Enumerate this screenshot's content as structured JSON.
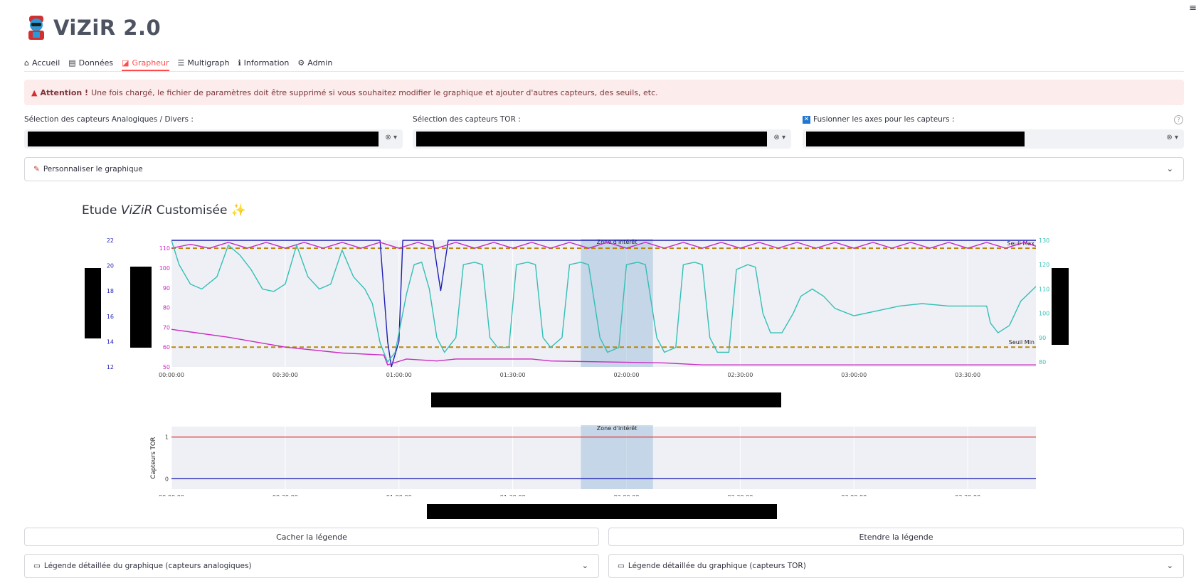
{
  "app": {
    "title": "ViZiR 2.0"
  },
  "tabs": [
    {
      "icon": "home-icon",
      "glyph": "⌂",
      "label": "Accueil"
    },
    {
      "icon": "data-icon",
      "glyph": "▤",
      "label": "Données"
    },
    {
      "icon": "chart-icon",
      "glyph": "◪",
      "label": "Grapheur",
      "active": true
    },
    {
      "icon": "list-icon",
      "glyph": "☰",
      "label": "Multigraph"
    },
    {
      "icon": "info-icon",
      "glyph": "ℹ",
      "label": "Information"
    },
    {
      "icon": "admin-icon",
      "glyph": "⚙",
      "label": "Admin"
    }
  ],
  "alert": {
    "bold": "Attention !",
    "text": "Une fois chargé, le fichier de paramètres doit être supprimé si vous souhaitez modifier le graphique et ajouter d'autres capteurs, des seuils, etc."
  },
  "selectors": {
    "analog_label": "Sélection des capteurs Analogiques / Divers :",
    "tor_label": "Sélection des capteurs TOR :",
    "merge_label": "Fusionner les axes pour les capteurs :",
    "ctrl_glyph": "⊗ ▾",
    "help_glyph": "?"
  },
  "expander": {
    "label": "Personnaliser le graphique"
  },
  "section": {
    "prefix": "Etude ",
    "emph": "ViZiR",
    "suffix": " Customisée",
    "emoji": "✨"
  },
  "buttons": {
    "hide_legend": "Cacher la légende",
    "extend_legend": "Etendre la légende"
  },
  "legends": {
    "analog": "Légende détaillée du graphique (capteurs analogiques)",
    "tor": "Légende détaillée du graphique (capteurs TOR)"
  },
  "colors": {
    "accent": "#ff4b4b",
    "plot_bg": "#e5ecf6",
    "zone": "#a9c4de",
    "blue": "#1f1fb4",
    "magenta": "#cc29c4",
    "teal": "#33bfb5",
    "threshold": "#b8860b",
    "red": "#e04646"
  },
  "chart_data": [
    {
      "type": "line",
      "title": "",
      "x_ticks": [
        "00:00:00",
        "00:30:00",
        "01:00:00",
        "01:30:00",
        "02:00:00",
        "02:30:00",
        "03:00:00",
        "03:30:00"
      ],
      "xlim": [
        "00:00:00",
        "03:48:00"
      ],
      "y_axes": [
        {
          "id": "blue",
          "side": "left",
          "ticks": [
            12,
            14,
            16,
            18,
            20,
            22
          ],
          "range": [
            12,
            22
          ]
        },
        {
          "id": "magenta",
          "side": "left",
          "ticks": [
            50,
            60,
            70,
            80,
            90,
            100,
            110
          ],
          "range": [
            50,
            114
          ]
        },
        {
          "id": "teal",
          "side": "right",
          "ticks": [
            80,
            90,
            100,
            110,
            120,
            130
          ],
          "range": [
            78,
            130
          ]
        }
      ],
      "zone": {
        "label": "Zone d'intérêt",
        "x0": "01:48:00",
        "x1": "02:07:00"
      },
      "thresholds": [
        {
          "label": "Seuil Max",
          "axis": "magenta",
          "value": 110
        },
        {
          "label": "Seuil Min",
          "axis": "magenta",
          "value": 60
        }
      ],
      "series": [
        {
          "axis": "blue",
          "color": "blue",
          "points": [
            [
              0,
              22
            ],
            [
              55,
              22
            ],
            [
              57,
              14
            ],
            [
              58,
              12
            ],
            [
              60,
              14
            ],
            [
              61,
              22
            ],
            [
              69,
              22
            ],
            [
              70,
              20
            ],
            [
              71,
              18
            ],
            [
              72,
              20
            ],
            [
              73,
              22
            ],
            [
              78,
              22
            ],
            [
              79,
              22
            ],
            [
              228,
              22
            ]
          ]
        },
        {
          "axis": "magenta",
          "color": "magenta",
          "points": [
            [
              0,
              110
            ],
            [
              5,
              112
            ],
            [
              10,
              110
            ],
            [
              15,
              113
            ],
            [
              20,
              110
            ],
            [
              25,
              113
            ],
            [
              30,
              110
            ],
            [
              35,
              113
            ],
            [
              40,
              110
            ],
            [
              45,
              113
            ],
            [
              50,
              110
            ],
            [
              55,
              113
            ],
            [
              60,
              110
            ],
            [
              65,
              113
            ],
            [
              70,
              110
            ],
            [
              75,
              113
            ],
            [
              80,
              110
            ],
            [
              85,
              113
            ],
            [
              90,
              110
            ],
            [
              95,
              113
            ],
            [
              100,
              110
            ],
            [
              105,
              113
            ],
            [
              110,
              110
            ],
            [
              115,
              113
            ],
            [
              120,
              110
            ],
            [
              125,
              113
            ],
            [
              130,
              110
            ],
            [
              135,
              113
            ],
            [
              140,
              110
            ],
            [
              145,
              113
            ],
            [
              150,
              110
            ],
            [
              155,
              113
            ],
            [
              160,
              110
            ],
            [
              165,
              113
            ],
            [
              170,
              110
            ],
            [
              175,
              113
            ],
            [
              180,
              110
            ],
            [
              185,
              113
            ],
            [
              190,
              110
            ],
            [
              195,
              113
            ],
            [
              200,
              110
            ],
            [
              205,
              113
            ],
            [
              210,
              110
            ],
            [
              215,
              113
            ],
            [
              220,
              110
            ],
            [
              225,
              113
            ],
            [
              228,
              111
            ]
          ]
        },
        {
          "axis": "magenta",
          "color": "magenta",
          "points": [
            [
              0,
              69
            ],
            [
              15,
              65
            ],
            [
              30,
              60
            ],
            [
              45,
              57
            ],
            [
              56,
              56
            ],
            [
              57,
              51
            ],
            [
              62,
              54
            ],
            [
              70,
              53
            ],
            [
              75,
              54
            ],
            [
              95,
              54
            ],
            [
              100,
              53
            ],
            [
              130,
              52
            ],
            [
              140,
              51
            ],
            [
              228,
              51
            ]
          ]
        },
        {
          "axis": "teal",
          "color": "teal",
          "points": [
            [
              0,
              130
            ],
            [
              2,
              120
            ],
            [
              5,
              112
            ],
            [
              8,
              110
            ],
            [
              12,
              115
            ],
            [
              15,
              128
            ],
            [
              18,
              124
            ],
            [
              21,
              118
            ],
            [
              24,
              110
            ],
            [
              27,
              109
            ],
            [
              30,
              112
            ],
            [
              33,
              128
            ],
            [
              36,
              115
            ],
            [
              39,
              110
            ],
            [
              42,
              112
            ],
            [
              45,
              126
            ],
            [
              48,
              115
            ],
            [
              51,
              110
            ],
            [
              53,
              104
            ],
            [
              55,
              88
            ],
            [
              57,
              80
            ],
            [
              59,
              84
            ],
            [
              62,
              108
            ],
            [
              64,
              120
            ],
            [
              66,
              121
            ],
            [
              68,
              110
            ],
            [
              70,
              90
            ],
            [
              72,
              84
            ],
            [
              75,
              90
            ],
            [
              77,
              120
            ],
            [
              80,
              121
            ],
            [
              82,
              120
            ],
            [
              84,
              90
            ],
            [
              86,
              86
            ],
            [
              89,
              86
            ],
            [
              91,
              120
            ],
            [
              94,
              121
            ],
            [
              96,
              120
            ],
            [
              98,
              90
            ],
            [
              100,
              86
            ],
            [
              103,
              90
            ],
            [
              105,
              120
            ],
            [
              108,
              121
            ],
            [
              110,
              120
            ],
            [
              113,
              90
            ],
            [
              115,
              84
            ],
            [
              118,
              86
            ],
            [
              120,
              120
            ],
            [
              123,
              121
            ],
            [
              125,
              120
            ],
            [
              128,
              90
            ],
            [
              130,
              84
            ],
            [
              133,
              86
            ],
            [
              135,
              120
            ],
            [
              138,
              121
            ],
            [
              140,
              120
            ],
            [
              142,
              90
            ],
            [
              144,
              84
            ],
            [
              147,
              84
            ],
            [
              149,
              118
            ],
            [
              152,
              120
            ],
            [
              154,
              119
            ],
            [
              156,
              100
            ],
            [
              158,
              92
            ],
            [
              161,
              92
            ],
            [
              164,
              100
            ],
            [
              166,
              107
            ],
            [
              169,
              110
            ],
            [
              172,
              107
            ],
            [
              175,
              102
            ],
            [
              180,
              99
            ],
            [
              186,
              101
            ],
            [
              192,
              103
            ],
            [
              198,
              104
            ],
            [
              205,
              103
            ],
            [
              210,
              103
            ],
            [
              215,
              103
            ],
            [
              216,
              96
            ],
            [
              218,
              92
            ],
            [
              221,
              95
            ],
            [
              224,
              105
            ],
            [
              228,
              111
            ]
          ]
        }
      ]
    },
    {
      "type": "line",
      "ylabel": "Capteurs TOR",
      "x_ticks": [
        "00:00:00",
        "00:30:00",
        "01:00:00",
        "01:30:00",
        "02:00:00",
        "02:30:00",
        "03:00:00",
        "03:30:00"
      ],
      "y_ticks": [
        0,
        1
      ],
      "ylim": [
        -0.25,
        1.25
      ],
      "zone": {
        "label": "Zone d'intérêt",
        "x0": "01:48:00",
        "x1": "02:07:00"
      },
      "series": [
        {
          "color": "red",
          "points": [
            [
              0,
              1
            ],
            [
              228,
              1
            ]
          ]
        },
        {
          "color": "blue",
          "points": [
            [
              0,
              0
            ],
            [
              228,
              0
            ]
          ]
        }
      ]
    }
  ]
}
